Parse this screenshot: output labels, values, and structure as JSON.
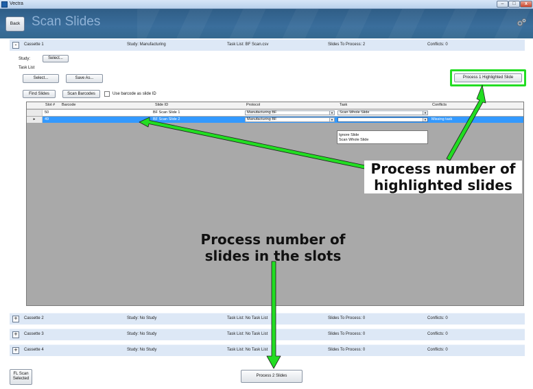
{
  "window": {
    "title": "Vectra",
    "min": "–",
    "max": "□",
    "close": "x"
  },
  "header": {
    "back_label": "Back",
    "title": "Scan Slides"
  },
  "cassettes": [
    {
      "toggle": "-",
      "name": "Cassette 1",
      "study": "Study: Manufacturing",
      "task_list": "Task List: BF Scan.csv",
      "slides": "Slides To Process: 2",
      "conflicts": "Conflicts: 0"
    },
    {
      "toggle": "+",
      "name": "Cassette 2",
      "study": "Study: No Study",
      "task_list": "Task List: No Task List",
      "slides": "Slides To Process: 0",
      "conflicts": "Conflicts: 0"
    },
    {
      "toggle": "+",
      "name": "Cassette 3",
      "study": "Study: No Study",
      "task_list": "Task List: No Task List",
      "slides": "Slides To Process: 0",
      "conflicts": "Conflicts: 0"
    },
    {
      "toggle": "+",
      "name": "Cassette 4",
      "study": "Study: No Study",
      "task_list": "Task List: No Task List",
      "slides": "Slides To Process: 0",
      "conflicts": "Conflicts: 0"
    }
  ],
  "panel": {
    "study_label": "Study:",
    "study_select": "Select...",
    "task_list_label": "Task List",
    "task_select": "Select...",
    "save_as": "Save As...",
    "find_slides": "Find Slides",
    "scan_barcodes": "Scan Barcodes",
    "use_barcode_label": "Use barcode as slide ID",
    "process_highlighted": "Process 1 Highlighted Slide"
  },
  "grid": {
    "columns": {
      "slot": "Slot #",
      "barcode": "Barcode",
      "slide_id": "Slide ID",
      "protocol": "Protocol",
      "task": "Task",
      "conflicts": "Conflicts"
    },
    "rows": [
      {
        "indicator": "",
        "slot": "50",
        "barcode": "",
        "slide_id": "BF Scan Slide 1",
        "protocol": "Manufacturing BF",
        "task": "Scan Whole Slide",
        "conflicts": ""
      },
      {
        "indicator": "▸",
        "slot": "49",
        "barcode": "",
        "slide_id": "BF Scan Slide 2",
        "protocol": "Manufacturing BF",
        "task": "",
        "conflicts": "Missing task"
      }
    ],
    "task_options": [
      "Ignore Slide",
      "Scan Whole Slide"
    ]
  },
  "footer": {
    "fl_scan": "FL Scan Selected",
    "process_slides": "Process 2 Slides"
  },
  "annotations": {
    "highlighted": "Process number of highlighted slides",
    "slots": "Process number of slides in the slots"
  },
  "colors": {
    "annotation": "#22dd22",
    "selection": "#3399ff",
    "header": "#34688f"
  }
}
